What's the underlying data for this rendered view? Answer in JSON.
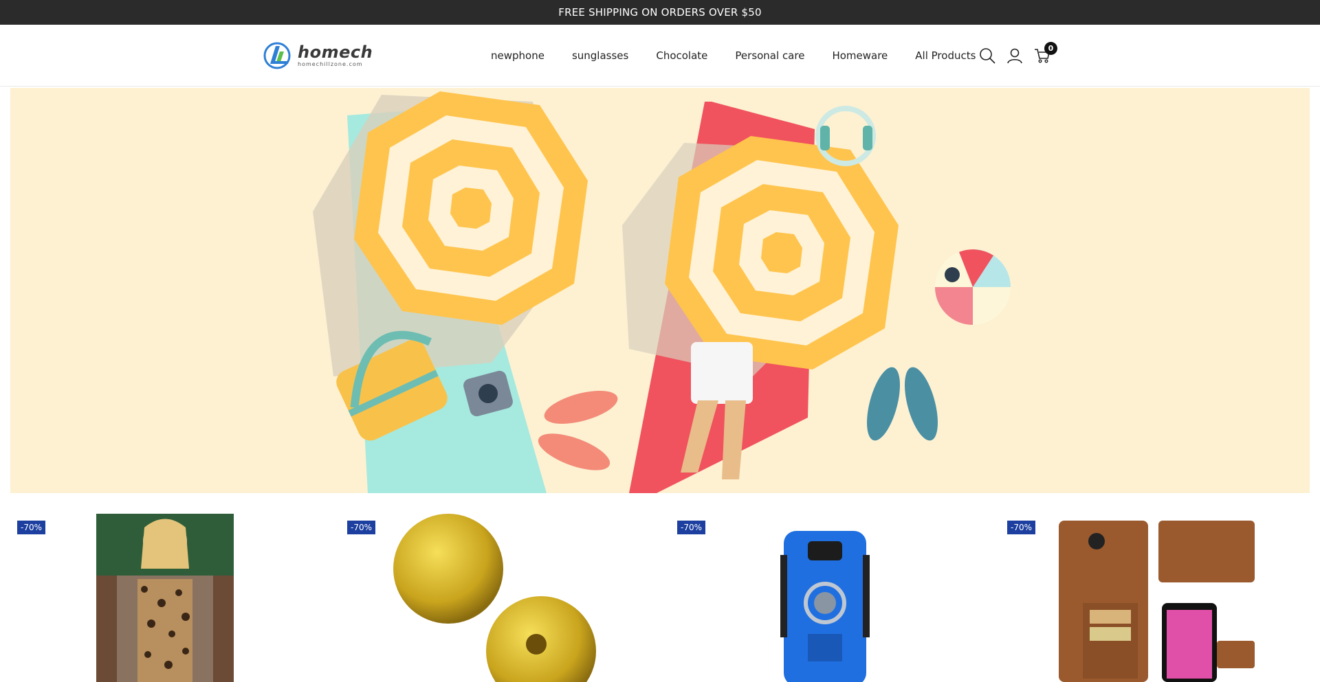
{
  "announcement": "FREE SHIPPING ON ORDERS OVER $50",
  "brand": {
    "name": "homech",
    "tagline": "homechillzone.com"
  },
  "nav": {
    "items": [
      {
        "label": "newphone"
      },
      {
        "label": "sunglasses"
      },
      {
        "label": "Chocolate"
      },
      {
        "label": "Personal care"
      },
      {
        "label": "Homeware"
      },
      {
        "label": "All Products"
      }
    ]
  },
  "header_icons": {
    "search": "search-icon",
    "account": "user-icon",
    "cart": "cart-icon",
    "cart_count": "0"
  },
  "hero": {
    "image": "beach-illustration"
  },
  "products": [
    {
      "badge": "-70%",
      "image": "leopard-jacket"
    },
    {
      "badge": "-70%",
      "image": "gold-beads"
    },
    {
      "badge": "-70%",
      "image": "blue-phone-case"
    },
    {
      "badge": "-70%",
      "image": "brown-wallet-case"
    }
  ],
  "colors": {
    "announce_bg": "#2b2b2b",
    "badge_bg": "#1c3fa0",
    "hero_bg": "#fdf1d2"
  }
}
